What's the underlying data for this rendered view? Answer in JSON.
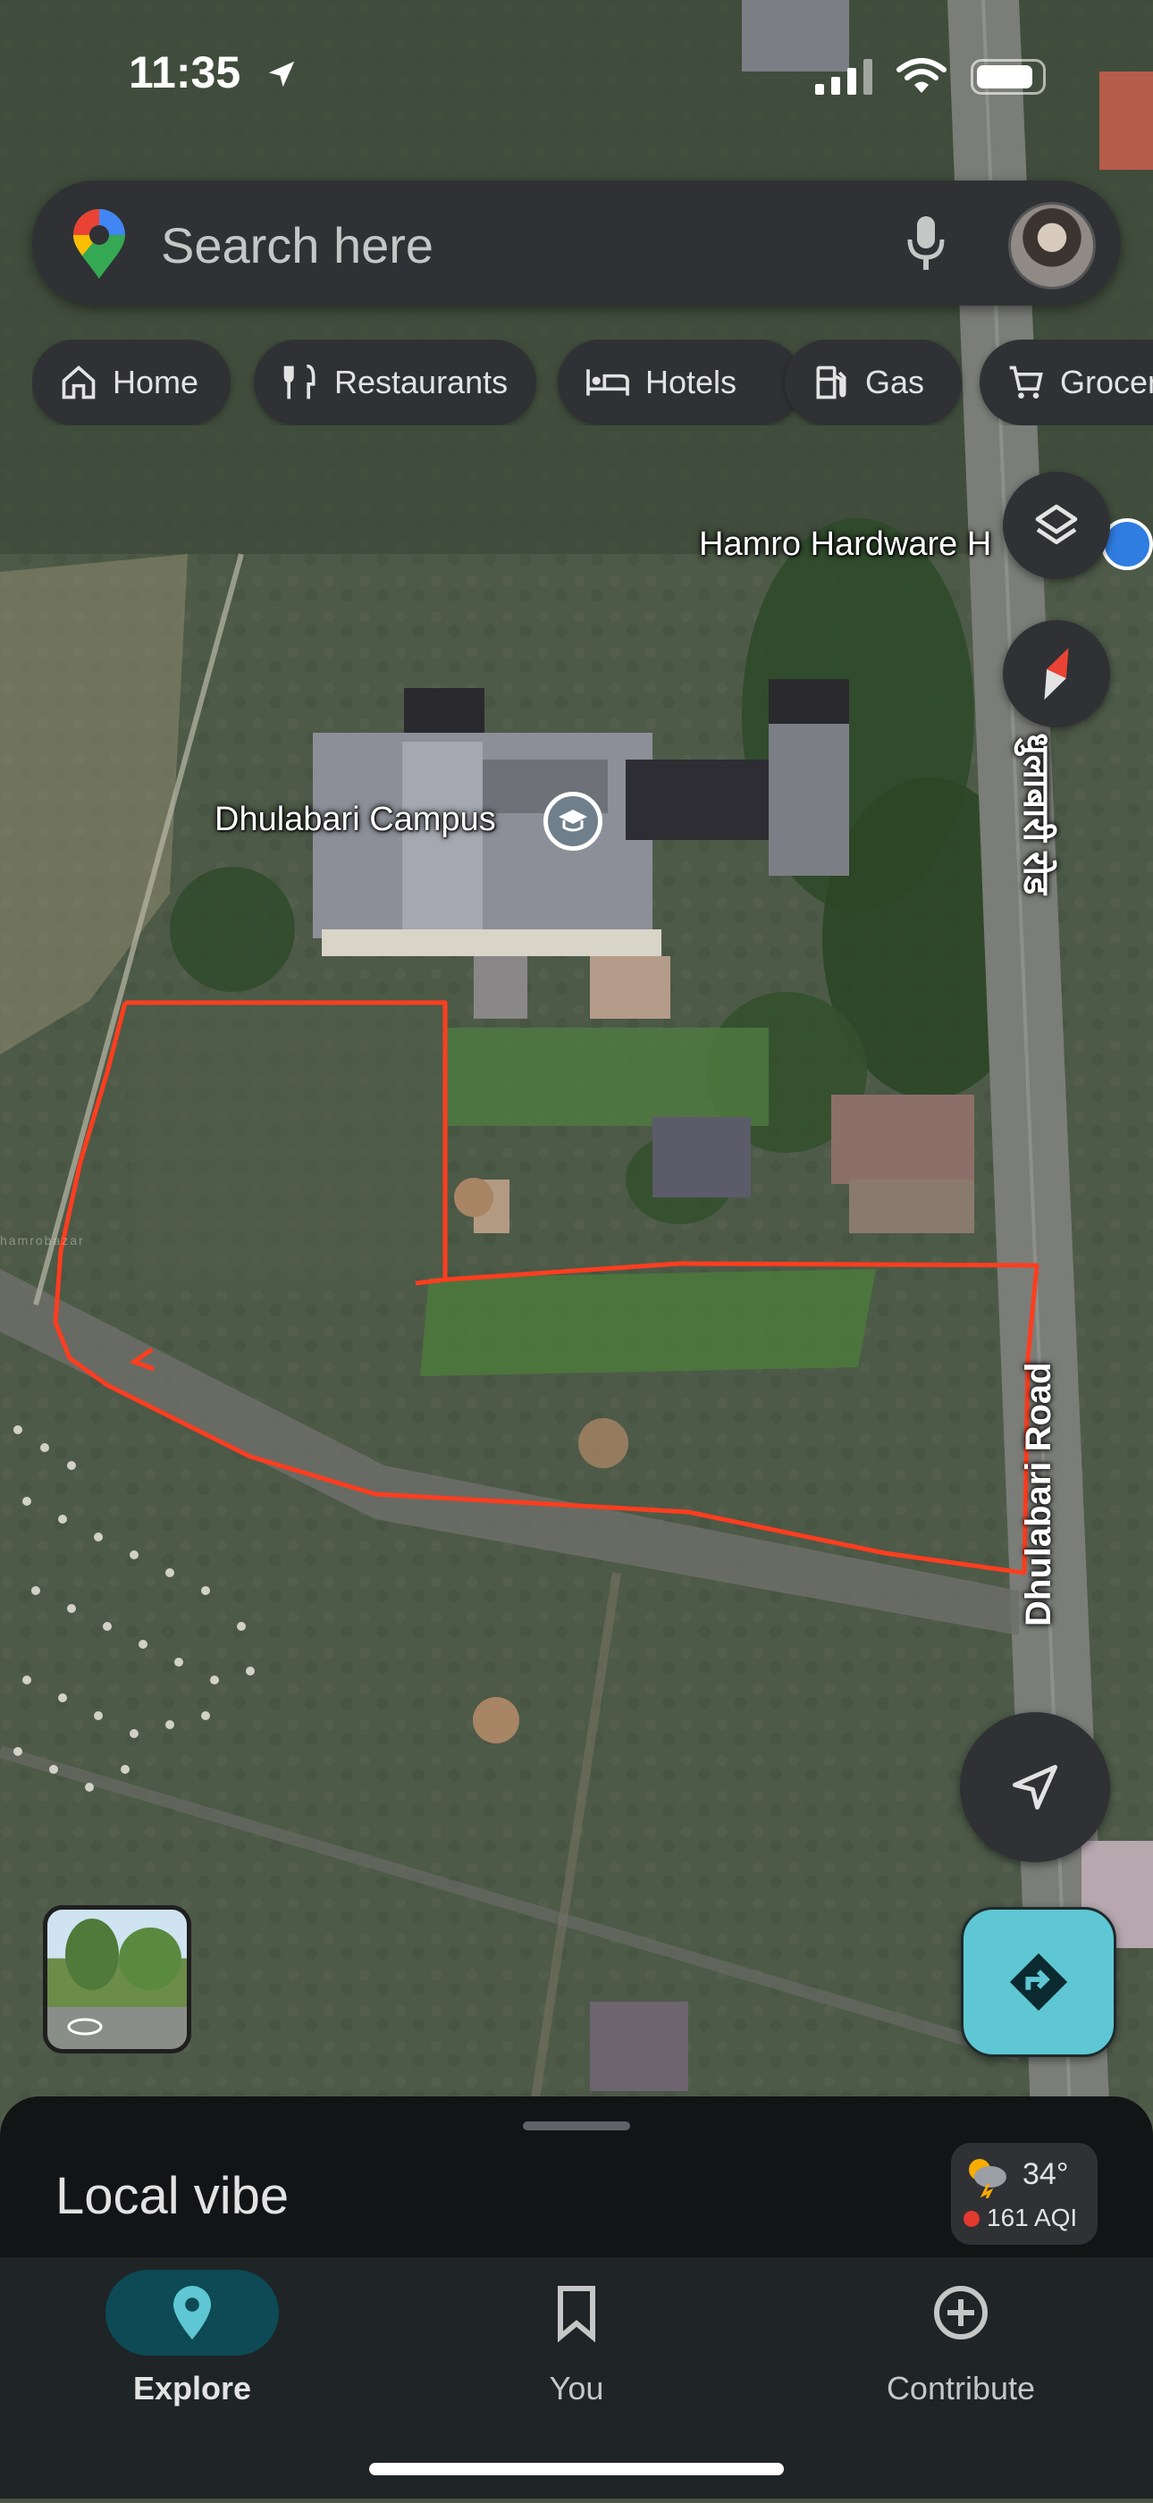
{
  "status_bar": {
    "time": "11:35"
  },
  "search": {
    "placeholder": "Search here"
  },
  "chips": [
    {
      "label": "Home",
      "icon": "home-icon"
    },
    {
      "label": "Restaurants",
      "icon": "restaurant-icon"
    },
    {
      "label": "Hotels",
      "icon": "hotel-icon"
    },
    {
      "label": "Gas",
      "icon": "gas-icon"
    },
    {
      "label": "Groceries",
      "icon": "cart-icon"
    }
  ],
  "map": {
    "places": {
      "campus": "Dhulabari Campus",
      "hardware": "Hamro Hardware H"
    },
    "roads": {
      "nepali": "धुलाबारी रोड",
      "english": "Dhulabari Road"
    },
    "watermark": "hamrobazar"
  },
  "sheet": {
    "title": "Local vibe",
    "weather": {
      "temp": "34°",
      "aqi": "161 AQI"
    }
  },
  "nav": {
    "explore": "Explore",
    "you": "You",
    "contribute": "Contribute"
  },
  "colors": {
    "accent": "#5ec7d3",
    "nav_active_pill": "#0d4a55",
    "boundary_line": "#ff3d1f",
    "aqi_dot": "#e23a2e"
  }
}
